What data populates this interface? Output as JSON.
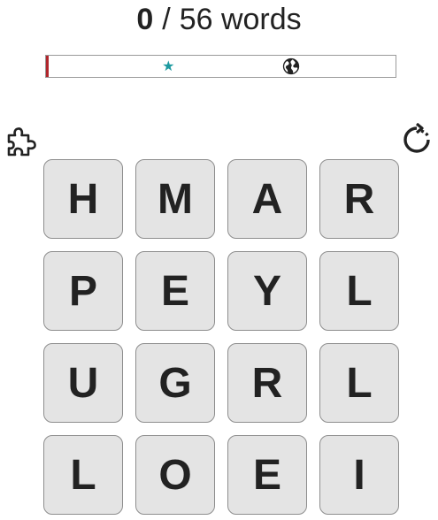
{
  "score": {
    "found": "0",
    "separator": "/",
    "total_text": "56 words"
  },
  "progress": {
    "fraction_found": 0.0,
    "fill_color": "#b0262c",
    "markers": [
      {
        "icon": "star-icon",
        "color": "#1d9aa0"
      },
      {
        "icon": "globe-icon",
        "color": "#222222"
      }
    ]
  },
  "toolbar": {
    "left_icon": "puzzle-piece-icon",
    "right_icon": "refresh-icon"
  },
  "board": {
    "rows": [
      [
        "H",
        "M",
        "A",
        "R"
      ],
      [
        "P",
        "E",
        "Y",
        "L"
      ],
      [
        "U",
        "G",
        "R",
        "L"
      ],
      [
        "L",
        "O",
        "E",
        "I"
      ]
    ]
  }
}
